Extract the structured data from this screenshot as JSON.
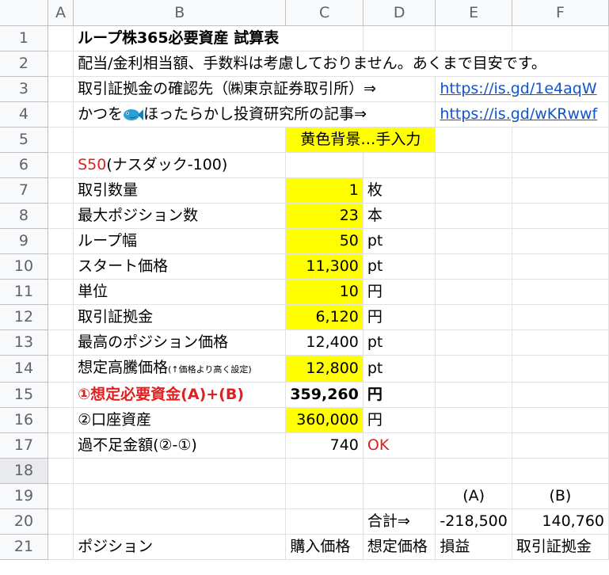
{
  "columns": [
    "A",
    "B",
    "C",
    "D",
    "E",
    "F"
  ],
  "rows": [
    "1",
    "2",
    "3",
    "4",
    "5",
    "6",
    "7",
    "8",
    "9",
    "10",
    "11",
    "12",
    "13",
    "14",
    "15",
    "16",
    "17",
    "18",
    "19",
    "20",
    "21"
  ],
  "title": "ループ株365必要資産 試算表",
  "note": "配当/金利相当額、手数料は考慮しておりません。あくまで目安です。",
  "margin_link_label": "取引証拠金の確認先（㈱東京証券取引所）⇒",
  "margin_link": "https://is.gd/1e4aqW",
  "article_prefix": "かつを",
  "article_suffix": "ほったらかし投資研究所の記事⇒",
  "article_link": "https://is.gd/wKRwwf",
  "input_legend": "黄色背景…手入力",
  "instrument_code": "S50",
  "instrument_name": "(ナスダック-100)",
  "params": [
    {
      "label": "取引数量",
      "value": "1",
      "unit": "枚"
    },
    {
      "label": "最大ポジション数",
      "value": "23",
      "unit": "本"
    },
    {
      "label": "ループ幅",
      "value": "50",
      "unit": "pt"
    },
    {
      "label": "スタート価格",
      "value": "11,300",
      "unit": "pt"
    },
    {
      "label": "単位",
      "value": "10",
      "unit": "円"
    },
    {
      "label": "取引証拠金",
      "value": "6,120",
      "unit": "円"
    },
    {
      "label": "最高のポジション価格",
      "value": "12,400",
      "unit": "pt"
    }
  ],
  "assumed_high": {
    "label": "想定高騰価格",
    "note": "(↑価格より高く設定)",
    "value": "12,800",
    "unit": "pt"
  },
  "required": {
    "label": "①想定必要資金(A)+(B)",
    "value": "359,260",
    "unit": "円"
  },
  "account": {
    "label": "②口座資産",
    "value": "360,000",
    "unit": "円"
  },
  "shortfall": {
    "label": "過不足金額(②-①)",
    "value": "740",
    "status": "OK"
  },
  "summary": {
    "a_label": "(A)",
    "b_label": "(B)",
    "total_label": "合計⇒",
    "total_a": "-218,500",
    "total_b": "140,760"
  },
  "headers": {
    "position": "ポジション",
    "buy": "購入価格",
    "assumed": "想定価格",
    "pnl": "損益",
    "margin": "取引証拠金"
  },
  "colors": {
    "input": "#ffff00",
    "alert": "#e02020",
    "link": "#1155cc"
  }
}
